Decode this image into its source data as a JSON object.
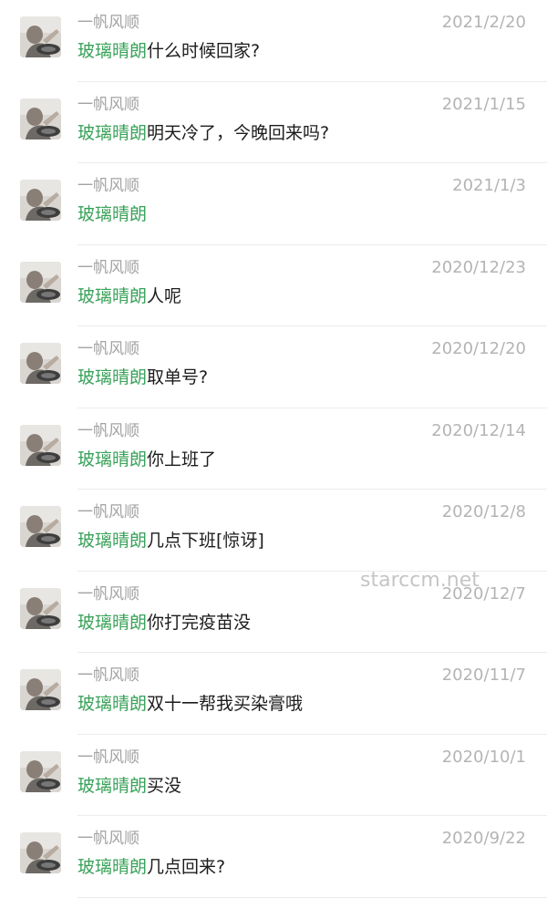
{
  "mention_name": "玻璃晴朗",
  "watermark": "starccm.net",
  "colors": {
    "mention": "#3aa25a",
    "date": "#b4b4b4",
    "sender": "#a3a3a3"
  },
  "messages": [
    {
      "sender": "一帆风顺",
      "date": "2021/2/20",
      "text": "什么时候回家?"
    },
    {
      "sender": "一帆风顺",
      "date": "2021/1/15",
      "text": "明天冷了，今晚回来吗?"
    },
    {
      "sender": "一帆风顺",
      "date": "2021/1/3",
      "text": ""
    },
    {
      "sender": "一帆风顺",
      "date": "2020/12/23",
      "text": "人呢"
    },
    {
      "sender": "一帆风顺",
      "date": "2020/12/20",
      "text": "取单号?"
    },
    {
      "sender": "一帆风顺",
      "date": "2020/12/14",
      "text": "你上班了"
    },
    {
      "sender": "一帆风顺",
      "date": "2020/12/8",
      "text": "几点下班[惊讶]"
    },
    {
      "sender": "一帆风顺",
      "date": "2020/12/7",
      "text": "你打完疫苗没"
    },
    {
      "sender": "一帆风顺",
      "date": "2020/11/7",
      "text": "双十一帮我买染膏哦"
    },
    {
      "sender": "一帆风顺",
      "date": "2020/10/1",
      "text": "买没"
    },
    {
      "sender": "一帆风顺",
      "date": "2020/9/22",
      "text": "几点回来?"
    }
  ]
}
